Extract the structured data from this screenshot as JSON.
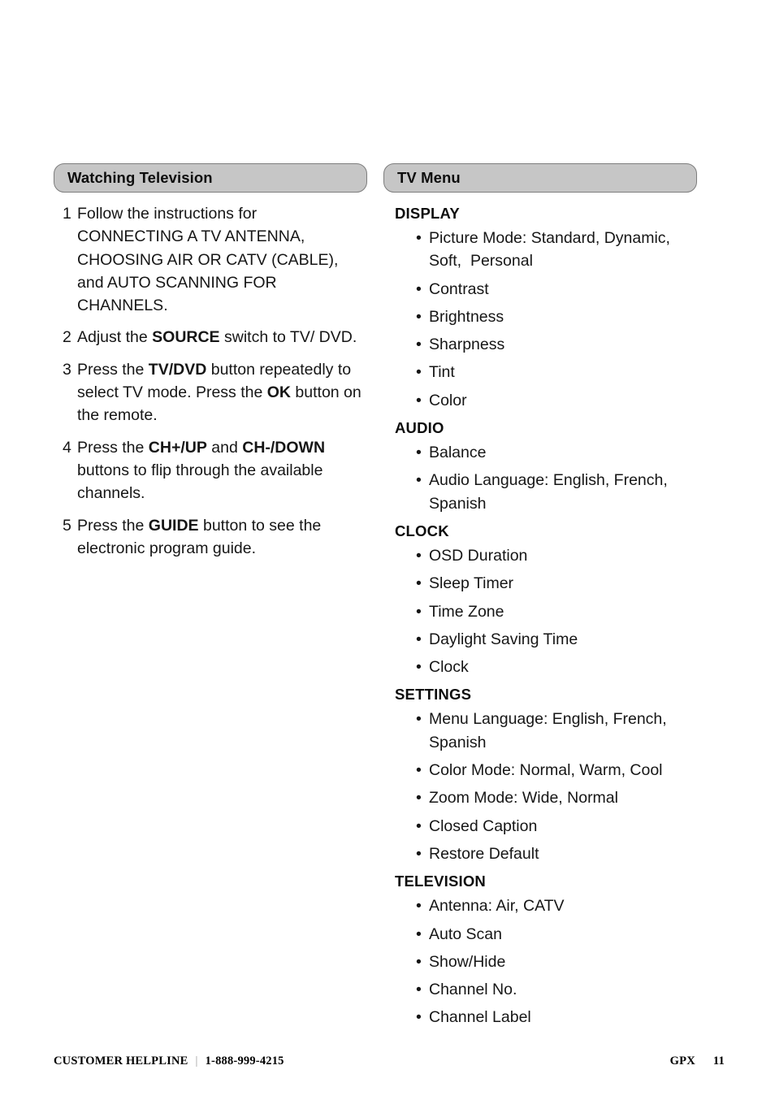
{
  "left_column": {
    "section_title": "Watching Television",
    "steps": [
      {
        "num": "1",
        "text": "Follow the instructions for CONNECTING A TV ANTENNA, CHOOSING AIR OR CATV (CABLE), and AUTO SCANNING FOR CHANNELS."
      },
      {
        "num": "2",
        "pre": "Adjust the ",
        "bold": "SOURCE",
        "post": " switch to TV/ DVD."
      },
      {
        "num": "3",
        "pre": "Press the ",
        "bold": "TV/DVD",
        "mid": " button repeatedly to select TV mode. Press the ",
        "bold2": "OK",
        "post": " button on the remote."
      },
      {
        "num": "4",
        "pre": "Press the ",
        "bold": "CH+/UP",
        "mid": " and ",
        "bold2": "CH-/DOWN",
        "post": " buttons to flip through the available channels."
      },
      {
        "num": "5",
        "pre": "Press the ",
        "bold": "GUIDE",
        "post": " button to see the electronic program guide."
      }
    ]
  },
  "right_column": {
    "section_title": "TV Menu",
    "groups": [
      {
        "heading": "DISPLAY",
        "items": [
          "Picture Mode: Standard, Dynamic, Soft,  Personal",
          "Contrast",
          "Brightness",
          "Sharpness",
          "Tint",
          "Color"
        ]
      },
      {
        "heading": "AUDIO",
        "items": [
          "Balance",
          "Audio Language: English, French, Spanish"
        ]
      },
      {
        "heading": "CLOCK",
        "items": [
          "OSD Duration",
          "Sleep Timer",
          "Time Zone",
          "Daylight Saving Time",
          "Clock"
        ]
      },
      {
        "heading": "SETTINGS",
        "items": [
          "Menu Language: English, French, Spanish",
          "Color Mode: Normal, Warm, Cool",
          "Zoom Mode: Wide, Normal",
          "Closed Caption",
          "Restore Default"
        ]
      },
      {
        "heading": "TELEVISION",
        "items": [
          "Antenna: Air, CATV",
          "Auto Scan",
          "Show/Hide",
          "Channel No.",
          "Channel Label"
        ]
      }
    ]
  },
  "footer": {
    "helpline_label": "CUSTOMER HELPLINE",
    "separator": "|",
    "phone": "1-888-999-4215",
    "brand": "GPX",
    "page_number": "11"
  },
  "bullet_glyph": "•",
  "colors": {
    "bar_fill": "#c6c6c6",
    "bar_border": "#7d7d7d",
    "text": "#161616",
    "footer_sep": "#9a9a9a"
  }
}
